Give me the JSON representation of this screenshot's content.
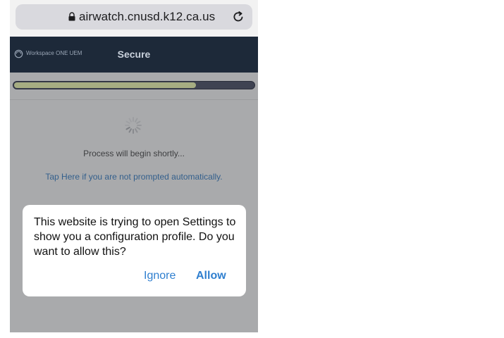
{
  "browser": {
    "url": "airwatch.cnusd.k12.ca.us",
    "lock_icon": "lock-icon",
    "reload_icon": "reload-icon"
  },
  "header": {
    "brand": "Workspace ONE UEM",
    "title": "Secure"
  },
  "progress": {
    "fraction": 0.76,
    "fill_color": "#a6ad82",
    "track_color": "#3f4352"
  },
  "content": {
    "status_text": "Process will begin shortly...",
    "link_text": "Tap Here if you are not prompted automatically."
  },
  "dialog": {
    "message": "This website is trying to open Settings to show you a configuration profile. Do you want to allow this?",
    "ignore_label": "Ignore",
    "allow_label": "Allow"
  },
  "colors": {
    "header_bg": "#1d2939",
    "accent": "#2f7fcf",
    "link": "#335f8c"
  }
}
